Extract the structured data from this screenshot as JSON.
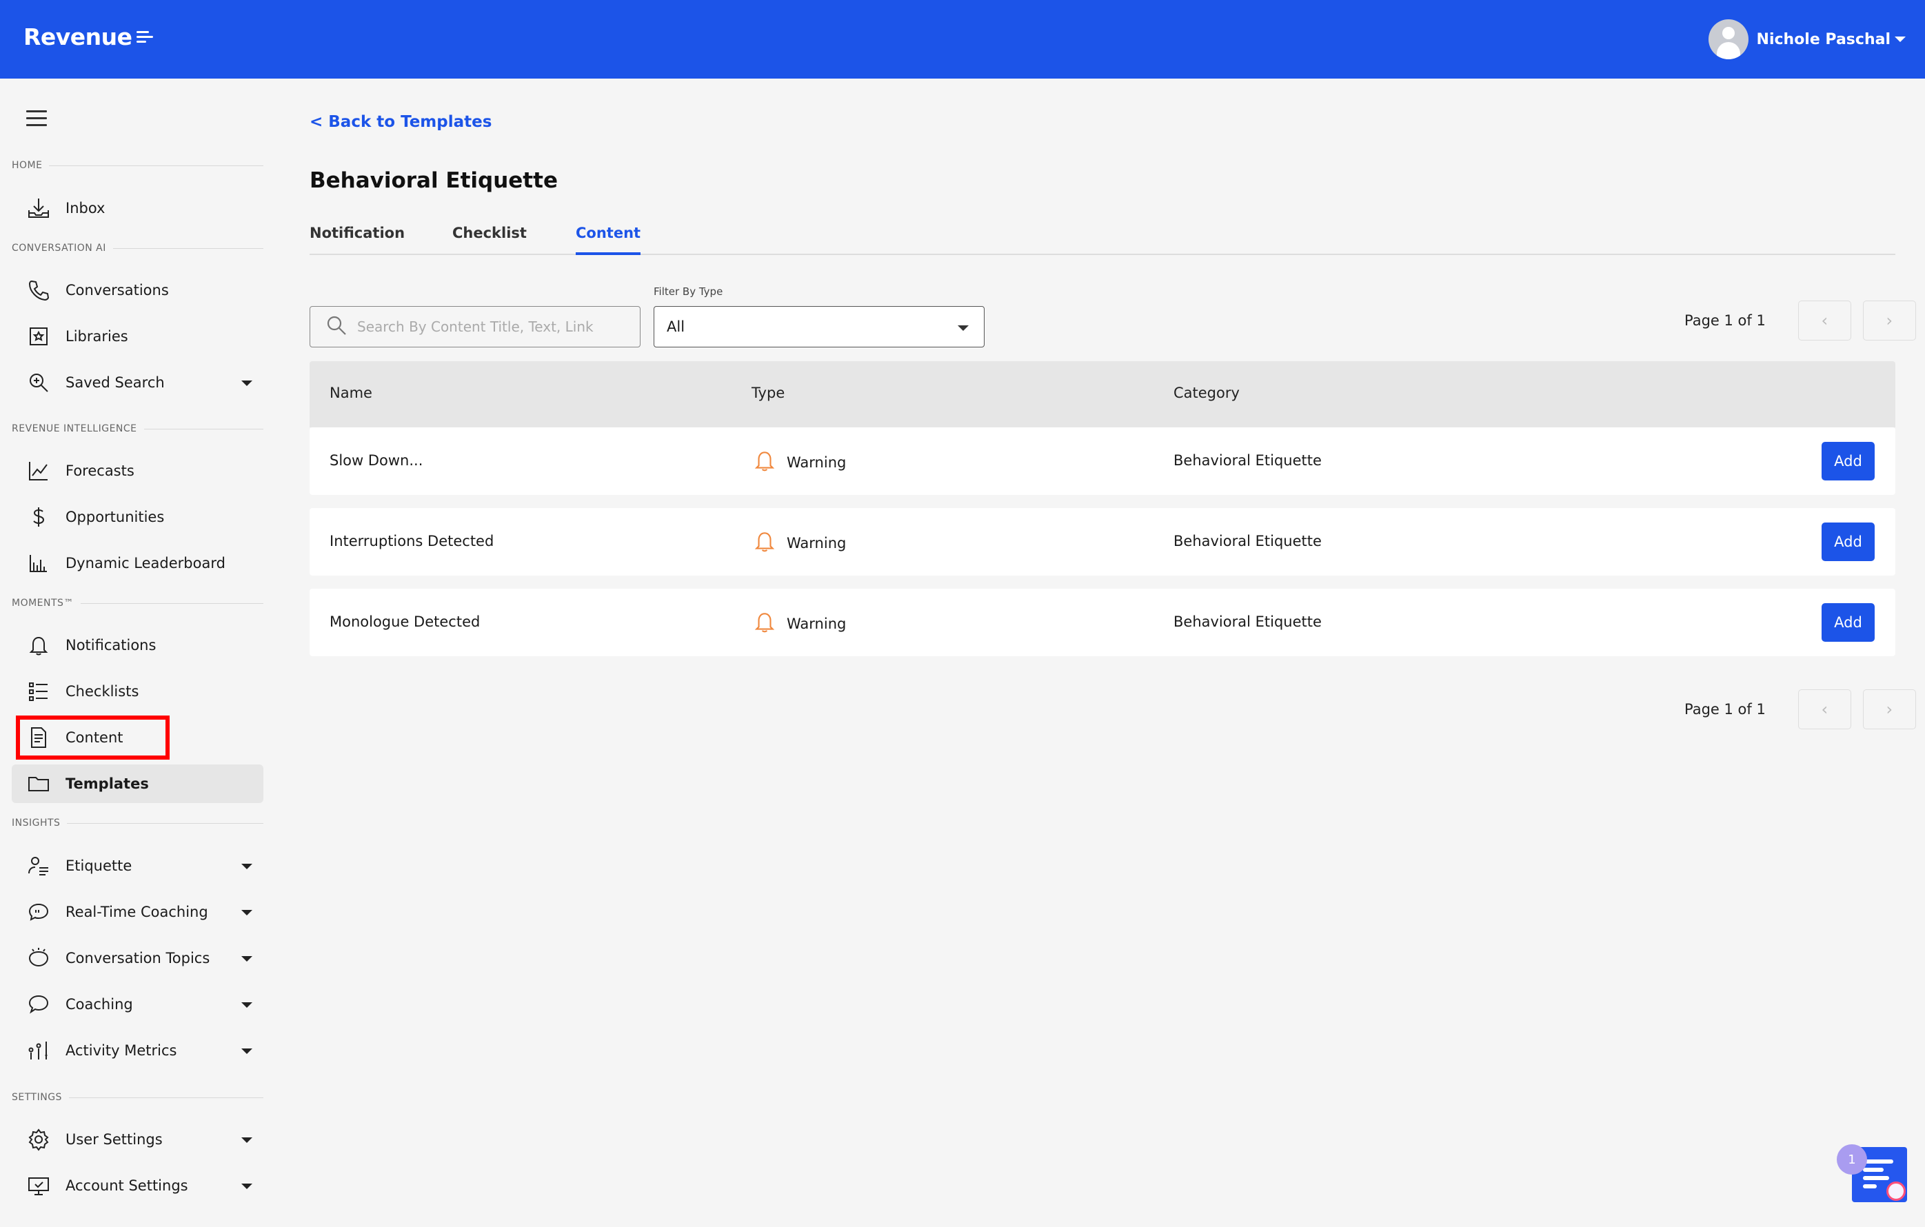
{
  "app": {
    "brand": "Revenue"
  },
  "user": {
    "name": "Nichole Paschal"
  },
  "sidebar": {
    "sections": {
      "home": "HOME",
      "conversation_ai": "CONVERSATION AI",
      "revenue_intelligence": "REVENUE INTELLIGENCE",
      "moments": "MOMENTS™",
      "insights": "INSIGHTS",
      "settings": "SETTINGS"
    },
    "items": {
      "inbox": "Inbox",
      "conversations": "Conversations",
      "libraries": "Libraries",
      "saved_search": "Saved Search",
      "forecasts": "Forecasts",
      "opportunities": "Opportunities",
      "dynamic_leaderboard": "Dynamic Leaderboard",
      "notifications": "Notifications",
      "checklists": "Checklists",
      "content": "Content",
      "templates": "Templates",
      "etiquette": "Etiquette",
      "real_time_coaching": "Real-Time Coaching",
      "conversation_topics": "Conversation Topics",
      "coaching": "Coaching",
      "activity_metrics": "Activity Metrics",
      "user_settings": "User Settings",
      "account_settings": "Account Settings"
    },
    "active": "templates",
    "highlighted": "content"
  },
  "main": {
    "back_link": "< Back to Templates",
    "title": "Behavioral Etiquette",
    "tabs": {
      "notification": "Notification",
      "checklist": "Checklist",
      "content": "Content"
    },
    "active_tab": "content",
    "search": {
      "placeholder": "Search By Content Title, Text, Link",
      "value": ""
    },
    "filter": {
      "label": "Filter By Type",
      "value": "All"
    },
    "pagination": {
      "text": "Page 1 of 1"
    },
    "table": {
      "headers": {
        "name": "Name",
        "type": "Type",
        "category": "Category"
      },
      "rows": [
        {
          "name": "Slow Down...",
          "type": "Warning",
          "category": "Behavioral Etiquette",
          "action": "Add"
        },
        {
          "name": "Interruptions Detected",
          "type": "Warning",
          "category": "Behavioral Etiquette",
          "action": "Add"
        },
        {
          "name": "Monologue Detected",
          "type": "Warning",
          "category": "Behavioral Etiquette",
          "action": "Add"
        }
      ]
    }
  },
  "chat_widget": {
    "badge_count": "1"
  },
  "colors": {
    "brand_blue": "#1c54e8",
    "warning_orange": "#f0883e",
    "highlight_red": "#ff0000"
  },
  "icons": {
    "inbox": "inbox-icon",
    "conversations": "phone-icon",
    "libraries": "library-icon",
    "saved_search": "search-plus-icon",
    "forecasts": "line-chart-icon",
    "opportunities": "dollar-icon",
    "dynamic_leaderboard": "bar-chart-icon",
    "notifications": "bell-icon",
    "checklists": "list-icon",
    "content": "document-icon",
    "templates": "folder-icon",
    "etiquette": "user-lines-icon",
    "real_time_coaching": "speech-quote-icon",
    "conversation_topics": "lightbulb-icon",
    "coaching": "chat-bubble-icon",
    "activity_metrics": "sliders-icon",
    "user_settings": "gear-icon",
    "account_settings": "monitor-check-icon"
  }
}
